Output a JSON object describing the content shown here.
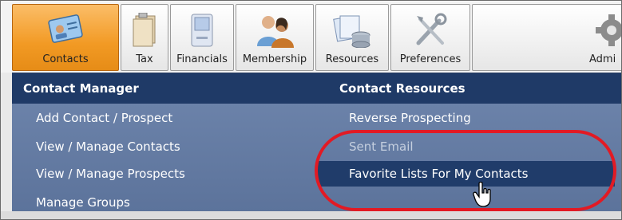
{
  "toolbar": {
    "tabs": [
      {
        "label": "Contacts",
        "icon": "contact-card-icon",
        "active": true
      },
      {
        "label": "Tax",
        "icon": "document-stack-icon",
        "active": false
      },
      {
        "label": "Financials",
        "icon": "calculator-icon",
        "active": false
      },
      {
        "label": "Membership",
        "icon": "people-icon",
        "active": false
      },
      {
        "label": "Resources",
        "icon": "database-docs-icon",
        "active": false
      },
      {
        "label": "Preferences",
        "icon": "tools-icon",
        "active": false
      },
      {
        "label": "Admi",
        "icon": "gear-icon",
        "active": false
      }
    ]
  },
  "menu": {
    "contact_manager": {
      "header": "Contact Manager",
      "items": [
        "Add Contact / Prospect",
        "View / Manage Contacts",
        "View / Manage Prospects",
        "Manage Groups"
      ]
    },
    "contact_resources": {
      "header": "Contact Resources",
      "items": [
        "Reverse Prospecting",
        "Sent Email",
        "Favorite Lists For My Contacts"
      ]
    },
    "highlighted_item": "Favorite Lists For My Contacts"
  },
  "colors": {
    "active_tab": "#f29a24",
    "menu_header": "#1f3a67",
    "menu_bg": "#5f76a0",
    "highlight": "#203c6a",
    "annotation_circle": "#e21a24"
  }
}
